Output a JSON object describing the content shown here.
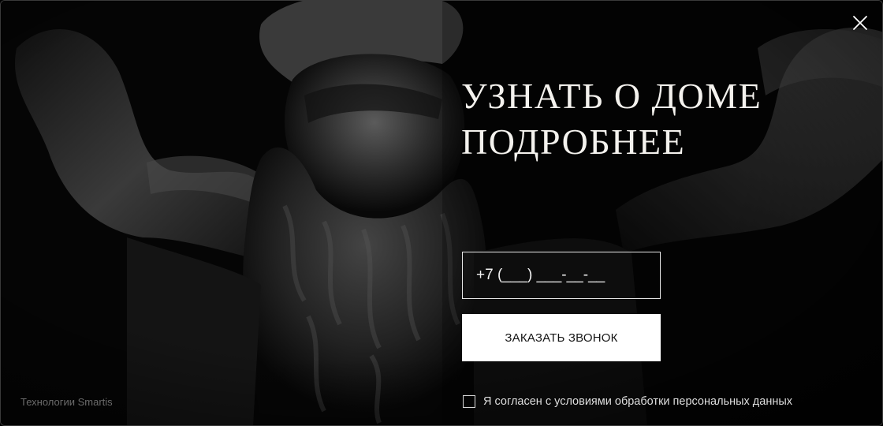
{
  "modal": {
    "title_lines": [
      "УЗНАТЬ О ДОМЕ",
      "ПОДРОБНЕЕ"
    ],
    "close_icon": "close-icon",
    "background_image": "bearded-atlas-sculpture"
  },
  "form": {
    "phone_placeholder": "+7 (___) ___-__-__",
    "submit_label": "ЗАКАЗАТЬ ЗВОНОК",
    "consent_label": "Я согласен с условиями обработки персональных данных",
    "consent_checked": false
  },
  "footer": {
    "brand_text": "Технологии Smartis"
  },
  "colors": {
    "background": "#050505",
    "text": "#f4f2ee",
    "button_bg": "#ffffff",
    "button_text": "#151515",
    "muted": "#6b6b6b"
  }
}
